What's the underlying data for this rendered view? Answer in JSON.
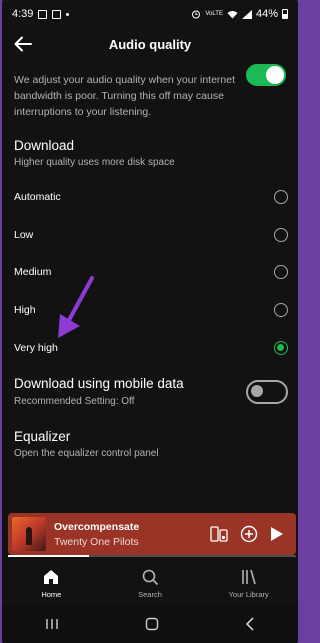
{
  "status_bar": {
    "time": "4:39",
    "battery": "44%",
    "battery_level": 0.44,
    "network": "VoLTE"
  },
  "header": {
    "title": "Audio quality",
    "back_icon": "arrow-left-icon"
  },
  "auto_adjust": {
    "description": "We adjust your audio quality when your internet bandwidth is poor. Turning this off may cause interruptions to your listening.",
    "enabled": true
  },
  "download": {
    "title": "Download",
    "subtitle": "Higher quality uses more disk space",
    "options": [
      {
        "label": "Automatic",
        "selected": false
      },
      {
        "label": "Low",
        "selected": false
      },
      {
        "label": "Medium",
        "selected": false
      },
      {
        "label": "High",
        "selected": false
      },
      {
        "label": "Very high",
        "selected": true
      }
    ]
  },
  "mobile_data": {
    "title": "Download using mobile data",
    "subtitle": "Recommended Setting: Off",
    "enabled": false
  },
  "equalizer": {
    "title": "Equalizer",
    "subtitle": "Open the equalizer control panel"
  },
  "mini_player": {
    "track_title": "Overcompensate",
    "artist": "Twenty One Pilots",
    "progress": 0.28
  },
  "bottom_nav": [
    {
      "label": "Home",
      "icon": "home-icon",
      "active": true
    },
    {
      "label": "Search",
      "icon": "search-icon",
      "active": false
    },
    {
      "label": "Your Library",
      "icon": "library-icon",
      "active": false
    }
  ],
  "colors": {
    "accent": "#1db954",
    "background": "#121212",
    "player": "#9a3427",
    "annotation": "#8e3ad6"
  }
}
